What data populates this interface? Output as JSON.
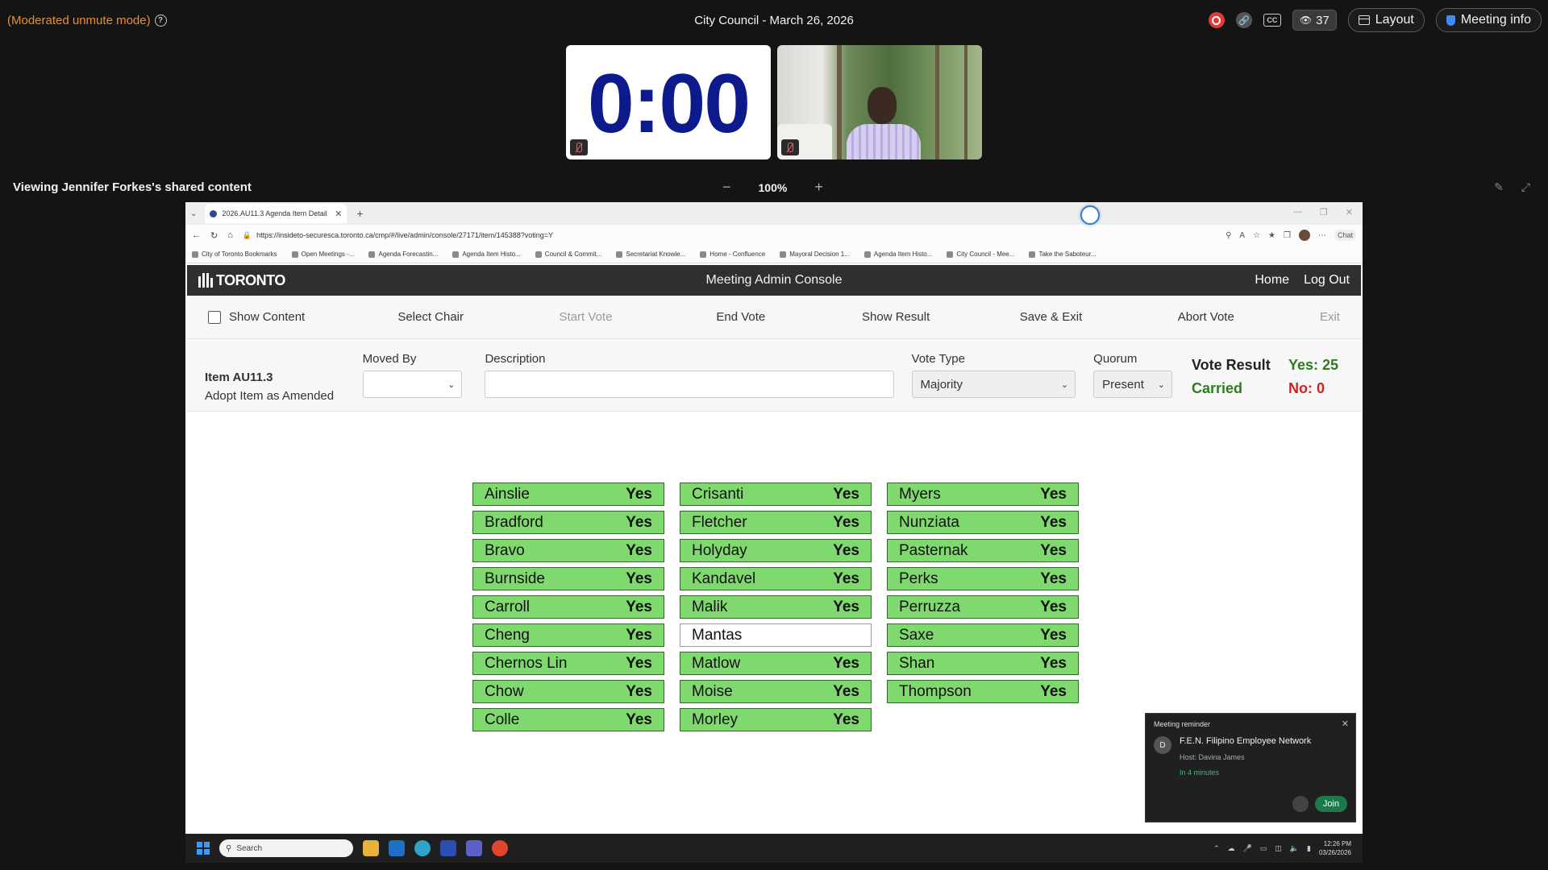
{
  "meeting": {
    "mode_label": "(Moderated unmute mode)",
    "title": "City Council - March 26, 2026",
    "participant_count": "37",
    "layout_label": "Layout",
    "info_label": "Meeting info",
    "timer": "0:00"
  },
  "share": {
    "viewing_label": "Viewing Jennifer Forkes's shared content",
    "zoom": "100%"
  },
  "browser": {
    "tab_title": "2026.AU11.3 Agenda Item Detail",
    "url": "https://insideto-securesca.toronto.ca/cmp/#/live/admin/console/27171/item/145388?voting=Y",
    "chat_label": "Chat",
    "bookmarks": [
      "City of Toronto Bookmarks",
      "Open Meetings -...",
      "Agenda Forecastin...",
      "Agenda Item Histo...",
      "Council & Commit...",
      "Secretariat Knowle...",
      "Home - Confluence",
      "Mayoral Decision 1...",
      "Agenda Item Histo...",
      "City Council - Mee...",
      "Take the Saboteur..."
    ]
  },
  "console": {
    "logo": "TORONTO",
    "title": "Meeting Admin Console",
    "nav": {
      "home": "Home",
      "logout": "Log Out"
    },
    "toolbar": {
      "show_content": "Show Content",
      "select_chair": "Select Chair",
      "start_vote": "Start Vote",
      "end_vote": "End Vote",
      "show_result": "Show Result",
      "save_exit": "Save & Exit",
      "abort_vote": "Abort Vote",
      "exit": "Exit"
    },
    "item": {
      "id": "Item AU11.3",
      "description": "Adopt Item as Amended"
    },
    "labels": {
      "moved_by": "Moved By",
      "description": "Description",
      "vote_type": "Vote Type",
      "quorum": "Quorum",
      "vote_result": "Vote Result"
    },
    "vote_type_value": "Majority",
    "quorum_value": "Present",
    "result": {
      "status": "Carried",
      "yes": "Yes: 25",
      "no": "No: 0"
    },
    "votes": [
      [
        {
          "name": "Ainslie",
          "vote": "Yes"
        },
        {
          "name": "Bradford",
          "vote": "Yes"
        },
        {
          "name": "Bravo",
          "vote": "Yes"
        },
        {
          "name": "Burnside",
          "vote": "Yes"
        },
        {
          "name": "Carroll",
          "vote": "Yes"
        },
        {
          "name": "Cheng",
          "vote": "Yes"
        },
        {
          "name": "Chernos Lin",
          "vote": "Yes"
        },
        {
          "name": "Chow",
          "vote": "Yes"
        },
        {
          "name": "Colle",
          "vote": "Yes"
        }
      ],
      [
        {
          "name": "Crisanti",
          "vote": "Yes"
        },
        {
          "name": "Fletcher",
          "vote": "Yes"
        },
        {
          "name": "Holyday",
          "vote": "Yes"
        },
        {
          "name": "Kandavel",
          "vote": "Yes"
        },
        {
          "name": "Malik",
          "vote": "Yes"
        },
        {
          "name": "Mantas",
          "vote": ""
        },
        {
          "name": "Matlow",
          "vote": "Yes"
        },
        {
          "name": "Moise",
          "vote": "Yes"
        },
        {
          "name": "Morley",
          "vote": "Yes"
        }
      ],
      [
        {
          "name": "Myers",
          "vote": "Yes"
        },
        {
          "name": "Nunziata",
          "vote": "Yes"
        },
        {
          "name": "Pasternak",
          "vote": "Yes"
        },
        {
          "name": "Perks",
          "vote": "Yes"
        },
        {
          "name": "Perruzza",
          "vote": "Yes"
        },
        {
          "name": "Saxe",
          "vote": "Yes"
        },
        {
          "name": "Shan",
          "vote": "Yes"
        },
        {
          "name": "Thompson",
          "vote": "Yes"
        }
      ]
    ]
  },
  "reminder": {
    "title": "Meeting reminder",
    "avatar": "D",
    "name": "F.E.N. Filipino Employee Network",
    "host": "Host: Davina James",
    "time": "In 4 minutes",
    "join": "Join"
  },
  "taskbar": {
    "search": "Search",
    "time": "12:26 PM",
    "date": "03/26/2026"
  }
}
